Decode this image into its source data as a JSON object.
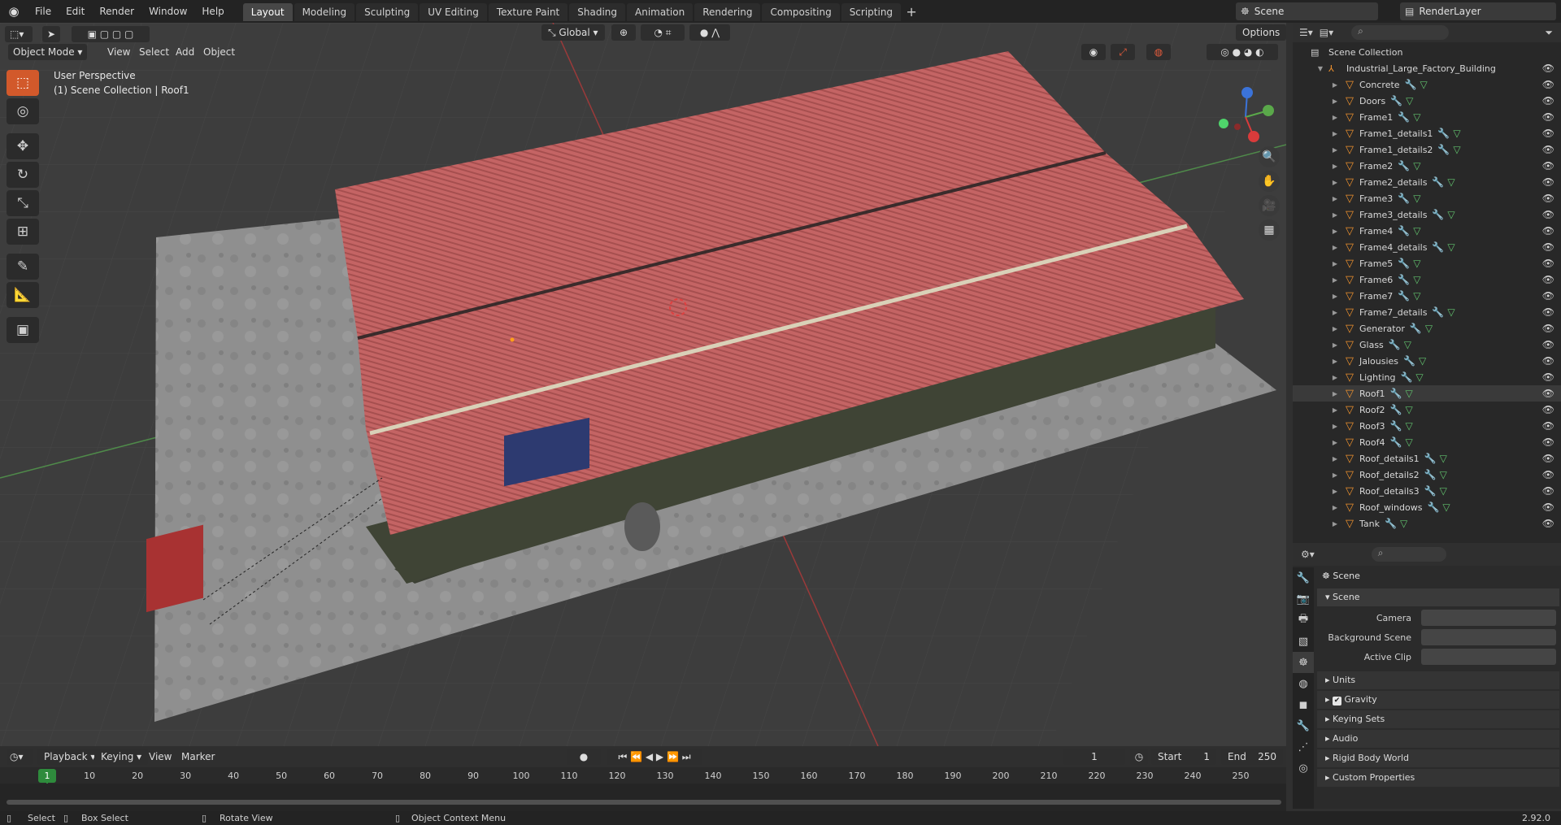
{
  "topbar": {
    "menus": [
      "File",
      "Edit",
      "Render",
      "Window",
      "Help"
    ],
    "workspaces": [
      "Layout",
      "Modeling",
      "Sculpting",
      "UV Editing",
      "Texture Paint",
      "Shading",
      "Animation",
      "Rendering",
      "Compositing",
      "Scripting"
    ],
    "active_workspace": "Layout",
    "scene": "Scene",
    "render_layer": "RenderLayer"
  },
  "viewport": {
    "mode": "Object Mode",
    "menus": [
      "View",
      "Select",
      "Add",
      "Object"
    ],
    "orientation": "Global",
    "options_label": "Options",
    "info_line1": "User Perspective",
    "info_line2": "(1) Scene Collection | Roof1"
  },
  "outliner": {
    "root": "Scene Collection",
    "collection": "Industrial_Large_Factory_Building",
    "selected": "Roof1",
    "objects": [
      "Concrete",
      "Doors",
      "Frame1",
      "Frame1_details1",
      "Frame1_details2",
      "Frame2",
      "Frame2_details",
      "Frame3",
      "Frame3_details",
      "Frame4",
      "Frame4_details",
      "Frame5",
      "Frame6",
      "Frame7",
      "Frame7_details",
      "Generator",
      "Glass",
      "Jalousies",
      "Lighting",
      "Roof1",
      "Roof2",
      "Roof3",
      "Roof4",
      "Roof_details1",
      "Roof_details2",
      "Roof_details3",
      "Roof_windows",
      "Tank"
    ]
  },
  "properties": {
    "context": "Scene",
    "section": "Scene",
    "fields": {
      "camera": "Camera",
      "background_scene": "Background Scene",
      "active_clip": "Active Clip"
    },
    "panels": [
      "Units",
      "Gravity",
      "Keying Sets",
      "Audio",
      "Rigid Body World",
      "Custom Properties"
    ]
  },
  "timeline": {
    "menus": [
      "Playback",
      "Keying",
      "View",
      "Marker"
    ],
    "current_frame": "1",
    "start_label": "Start",
    "start": "1",
    "end_label": "End",
    "end": "250",
    "ticks": [
      "10",
      "20",
      "30",
      "40",
      "50",
      "60",
      "70",
      "80",
      "90",
      "100",
      "110",
      "120",
      "130",
      "140",
      "150",
      "160",
      "170",
      "180",
      "190",
      "200",
      "210",
      "220",
      "230",
      "240",
      "250"
    ],
    "indicator": "1"
  },
  "statusbar": {
    "select": "Select",
    "box_select": "Box Select",
    "rotate_view": "Rotate View",
    "context_menu": "Object Context Menu",
    "version": "2.92.0"
  }
}
